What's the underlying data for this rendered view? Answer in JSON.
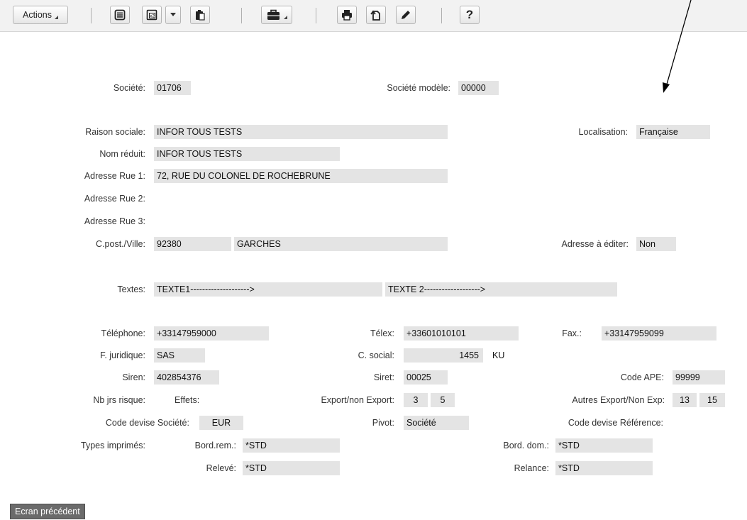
{
  "toolbar": {
    "actions_label": "Actions",
    "help_label": "?",
    "icons": [
      "list-icon",
      "calculator-icon",
      "dropdown-arrow-icon",
      "clipboard-icon",
      "briefcase-icon",
      "printer-icon",
      "document-copy-icon",
      "pencil-icon",
      "help-icon"
    ]
  },
  "form": {
    "societe": {
      "label": "Société:",
      "value": "01706"
    },
    "societe_modele": {
      "label": "Société modèle:",
      "value": "00000"
    },
    "raison_sociale": {
      "label": "Raison sociale:",
      "value": "INFOR TOUS TESTS"
    },
    "localisation": {
      "label": "Localisation:",
      "value": "Française"
    },
    "nom_reduit": {
      "label": "Nom réduit:",
      "value": "INFOR TOUS TESTS"
    },
    "adresse_rue1": {
      "label": "Adresse Rue 1:",
      "value": "72, RUE DU COLONEL DE ROCHEBRUNE"
    },
    "adresse_rue2": {
      "label": "Adresse Rue 2:",
      "value": ""
    },
    "adresse_rue3": {
      "label": "Adresse Rue 3:",
      "value": ""
    },
    "cpost_ville": {
      "label": "C.post./Ville:",
      "cp": "92380",
      "ville": "GARCHES"
    },
    "adresse_editer": {
      "label": "Adresse à éditer:",
      "value": "Non"
    },
    "textes": {
      "label": "Textes:",
      "texte1": "TEXTE1-------------------->",
      "texte2": "TEXTE 2------------------->"
    },
    "telephone": {
      "label": "Téléphone:",
      "value": "+33147959000"
    },
    "telex": {
      "label": "Télex:",
      "value": "+33601010101"
    },
    "fax": {
      "label": "Fax.:",
      "value": "+33147959099"
    },
    "f_juridique": {
      "label": "F. juridique:",
      "value": "SAS"
    },
    "c_social": {
      "label": "C. social:",
      "value": "1455",
      "unit": "KU"
    },
    "siren": {
      "label": "Siren:",
      "value": "402854376"
    },
    "siret": {
      "label": "Siret:",
      "value": "00025"
    },
    "code_ape": {
      "label": "Code APE:",
      "value": "99999"
    },
    "nb_jrs_risque": {
      "label": "Nb jrs risque:",
      "effets_label": "Effets:"
    },
    "export_non_export": {
      "label": "Export/non Export:",
      "v1": "3",
      "v2": "5"
    },
    "autres_export": {
      "label": "Autres Export/Non Exp:",
      "v1": "13",
      "v2": "15"
    },
    "code_devise_societe": {
      "label": "Code devise Société:",
      "value": "EUR"
    },
    "pivot": {
      "label": "Pivot:",
      "value": "Société"
    },
    "code_devise_reference": {
      "label": "Code devise Référence:",
      "value": ""
    },
    "types_imprimes": {
      "label": "Types imprimés:"
    },
    "bord_rem": {
      "label": "Bord.rem.:",
      "value": "*STD"
    },
    "bord_dom": {
      "label": "Bord. dom.:",
      "value": "*STD"
    },
    "releve": {
      "label": "Relevé:",
      "value": "*STD"
    },
    "relance": {
      "label": "Relance:",
      "value": "*STD"
    }
  },
  "footer": {
    "prev_button": "Ecran précédent"
  }
}
